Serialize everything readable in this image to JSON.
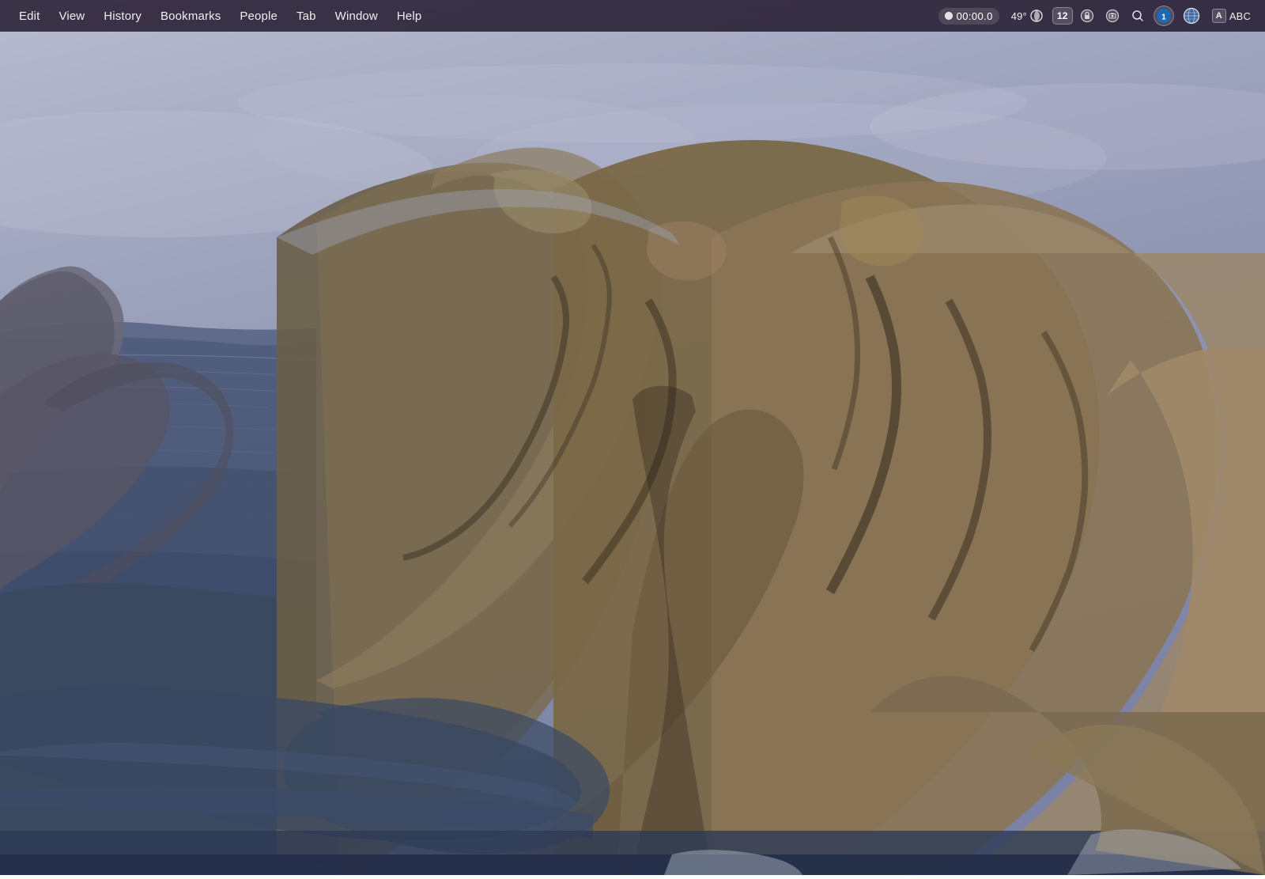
{
  "menubar": {
    "items": [
      {
        "label": "Edit",
        "id": "edit"
      },
      {
        "label": "View",
        "id": "view"
      },
      {
        "label": "History",
        "id": "history"
      },
      {
        "label": "Bookmarks",
        "id": "bookmarks"
      },
      {
        "label": "People",
        "id": "people"
      },
      {
        "label": "Tab",
        "id": "tab"
      },
      {
        "label": "Window",
        "id": "window"
      },
      {
        "label": "Help",
        "id": "help"
      }
    ],
    "recording": {
      "time": "00:00.0"
    },
    "temperature": "49°",
    "tab_count": "12",
    "input_method": "ABC"
  },
  "background": {
    "description": "macOS Big Sur style coastal mountain landscape at dusk",
    "sky_color": "#8b8faa",
    "water_color": "#4a5275",
    "mountain_color": "#5a4e3a",
    "rock_color": "#7a6a52"
  }
}
